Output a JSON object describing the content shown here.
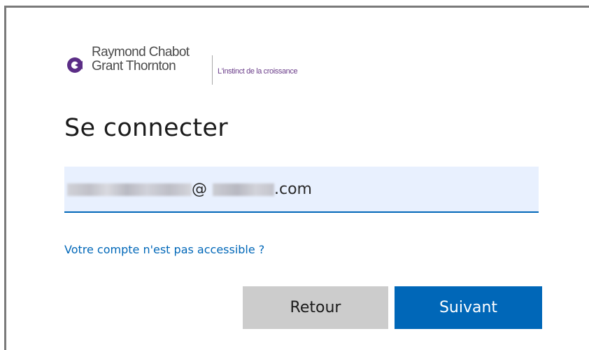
{
  "brand": {
    "name_line1": "Raymond Chabot",
    "name_line2": "Grant Thornton",
    "tagline": "L'instinct de la croissance",
    "logo_icon": "rcgt-logo-icon",
    "colors": {
      "logo_purple": "#5b2d86",
      "tagline": "#6b3e8a"
    }
  },
  "signin": {
    "title": "Se connecter",
    "email": {
      "visible_at": "@",
      "visible_tld": ".com",
      "obscured": true
    },
    "cant_access_link": "Votre compte n'est pas accessible ?",
    "back_button": "Retour",
    "next_button": "Suivant"
  },
  "colors": {
    "accent": "#0067b8",
    "input_bg": "#e8f0fe",
    "back_button_bg": "#cccccc",
    "text": "#1b1b1b"
  }
}
